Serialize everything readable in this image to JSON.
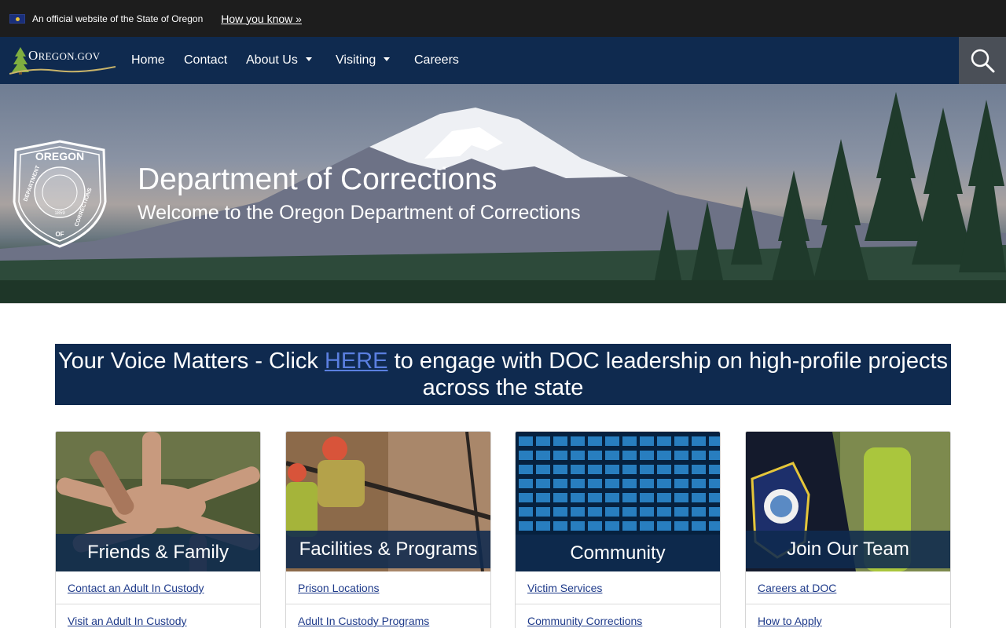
{
  "official_bar": {
    "text": "An official website of the State of Oregon",
    "how_link": "How you know »"
  },
  "nav": {
    "logo_main": "O",
    "logo_rest": "REGON.GOV",
    "items": [
      {
        "label": "Home"
      },
      {
        "label": "Contact"
      },
      {
        "label": "About Us"
      },
      {
        "label": "Visiting"
      },
      {
        "label": "Careers"
      }
    ]
  },
  "hero": {
    "title": "Department of Corrections",
    "subtitle": "Welcome to the Oregon Department of Corrections",
    "seal_top": "OREGON",
    "seal_left": "DEPARTMENT",
    "seal_bottom": "OF",
    "seal_right": "CORRECTIONS",
    "seal_year": "1859"
  },
  "voice": {
    "before": "Your Voice Matters - Click ",
    "link": "HERE",
    "after": " to engage with DOC leadership on high-profile projects across the state"
  },
  "cards": [
    {
      "title": "Friends & Family",
      "links": [
        "Contact an Adult In Custody",
        "Visit an Adult In Custody"
      ]
    },
    {
      "title": "Facilities & Programs",
      "links": [
        "Prison Locations",
        "Adult In Custody Programs"
      ]
    },
    {
      "title": "Community",
      "links": [
        "Victim Services",
        "Community Corrections"
      ]
    },
    {
      "title": "Join Our Team",
      "links": [
        "Careers at DOC",
        "How to Apply"
      ]
    }
  ],
  "colors": {
    "navy": "#0f2a4f",
    "banner_black": "#1d1d1d",
    "link_blue": "#1e3a8a",
    "search_gray": "#4a4f57"
  }
}
